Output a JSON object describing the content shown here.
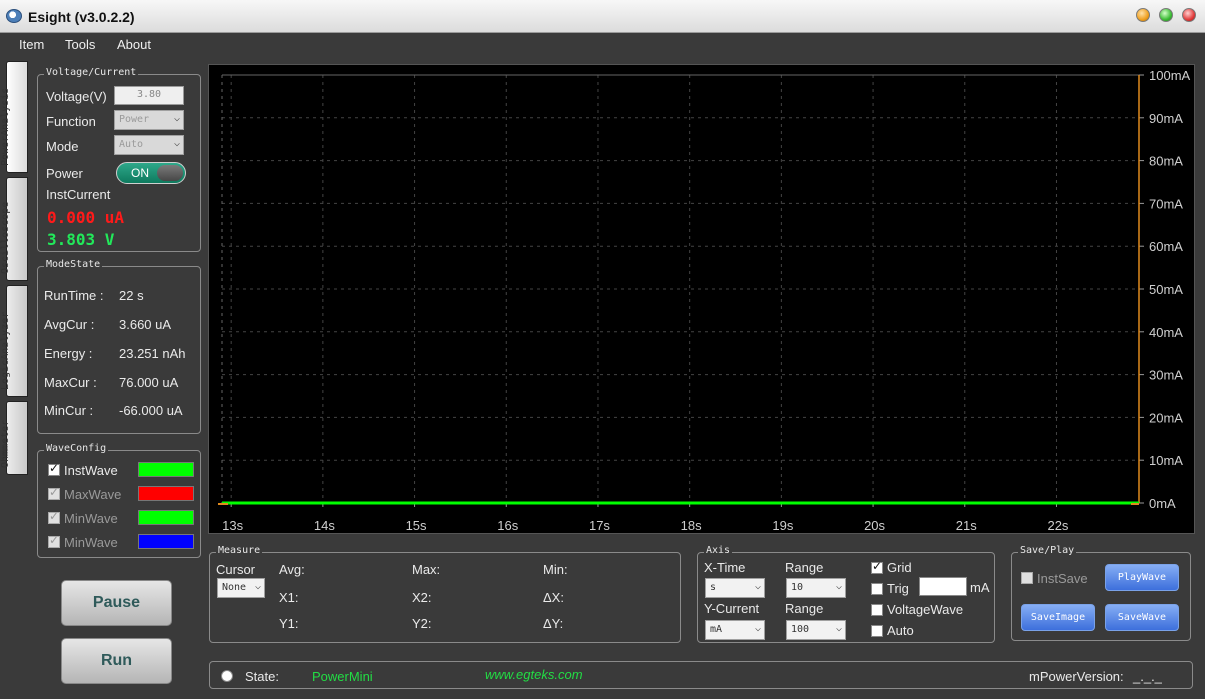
{
  "window": {
    "title": "Esight (v3.0.2.2)"
  },
  "menu": [
    "Item",
    "Tools",
    "About"
  ],
  "side_tabs": [
    "PowerAnalysis",
    "Oscilloscope",
    "LogicAnalyzer",
    "Ohmmeter"
  ],
  "voltage_current": {
    "title": "Voltage/Current",
    "voltage_label": "Voltage(V)",
    "voltage_value": "3.80",
    "function_label": "Function",
    "function_value": "Power",
    "mode_label": "Mode",
    "mode_value": "Auto",
    "power_label": "Power",
    "power_state": "ON",
    "inst_current_label": "InstCurrent",
    "inst_current_value": "0.000 uA",
    "inst_voltage_value": "3.803 V"
  },
  "mode_state": {
    "title": "ModeState",
    "rows": [
      {
        "label": "RunTime :",
        "value": "22 s"
      },
      {
        "label": "AvgCur :",
        "value": "3.660 uA"
      },
      {
        "label": "Energy :",
        "value": "23.251 nAh"
      },
      {
        "label": "MaxCur :",
        "value": "76.000 uA"
      },
      {
        "label": "MinCur :",
        "value": "-66.000 uA"
      }
    ]
  },
  "wave_config": {
    "title": "WaveConfig",
    "items": [
      {
        "label": "InstWave",
        "checked": true,
        "enabled": true,
        "color": "#00ff00"
      },
      {
        "label": "MaxWave",
        "checked": true,
        "enabled": false,
        "color": "#ff0000"
      },
      {
        "label": "MinWave",
        "checked": true,
        "enabled": false,
        "color": "#00ff00"
      },
      {
        "label": "MinWave",
        "checked": true,
        "enabled": false,
        "color": "#0000ff"
      }
    ]
  },
  "buttons": {
    "pause": "Pause",
    "run": "Run"
  },
  "chart_data": {
    "type": "line",
    "title": "",
    "xlabel": "",
    "ylabel": "",
    "x_ticks": [
      "13s",
      "14s",
      "15s",
      "16s",
      "17s",
      "18s",
      "19s",
      "20s",
      "21s",
      "22s"
    ],
    "y_ticks": [
      "0mA",
      "10mA",
      "20mA",
      "30mA",
      "40mA",
      "50mA",
      "60mA",
      "70mA",
      "80mA",
      "90mA",
      "100mA"
    ],
    "xlim": [
      12.9,
      22.9
    ],
    "ylim": [
      0,
      100
    ],
    "grid": true,
    "series": [
      {
        "color": "#00ff00",
        "x": [
          12.9,
          22.9
        ],
        "y": [
          0,
          0
        ]
      }
    ]
  },
  "measure": {
    "title": "Measure",
    "cursor_label": "Cursor",
    "cursor_value": "None",
    "avg": "Avg:",
    "max": "Max:",
    "min": "Min:",
    "x1": "X1:",
    "x2": "X2:",
    "dx": "ΔX:",
    "y1": "Y1:",
    "y2": "Y2:",
    "dy": "ΔY:"
  },
  "axis": {
    "title": "Axis",
    "xtime_label": "X-Time",
    "xtime_value": "s",
    "range_label": "Range",
    "xrange_value": "10",
    "ycurrent_label": "Y-Current",
    "ycurrent_value": "mA",
    "yrange_value": "100",
    "grid_label": "Grid",
    "grid_checked": true,
    "trig_label": "Trig",
    "trig_unit": "mA",
    "voltagewave_label": "VoltageWave",
    "auto_label": "Auto"
  },
  "save_play": {
    "title": "Save/Play",
    "instsave_label": "InstSave",
    "playwave": "PlayWave",
    "saveimage": "SaveImage",
    "savewave": "SaveWave"
  },
  "status": {
    "state_label": "State:",
    "state_value": "PowerMini",
    "url": "www.egteks.com",
    "version_label": "mPowerVersion:",
    "version_value": "_._._"
  }
}
